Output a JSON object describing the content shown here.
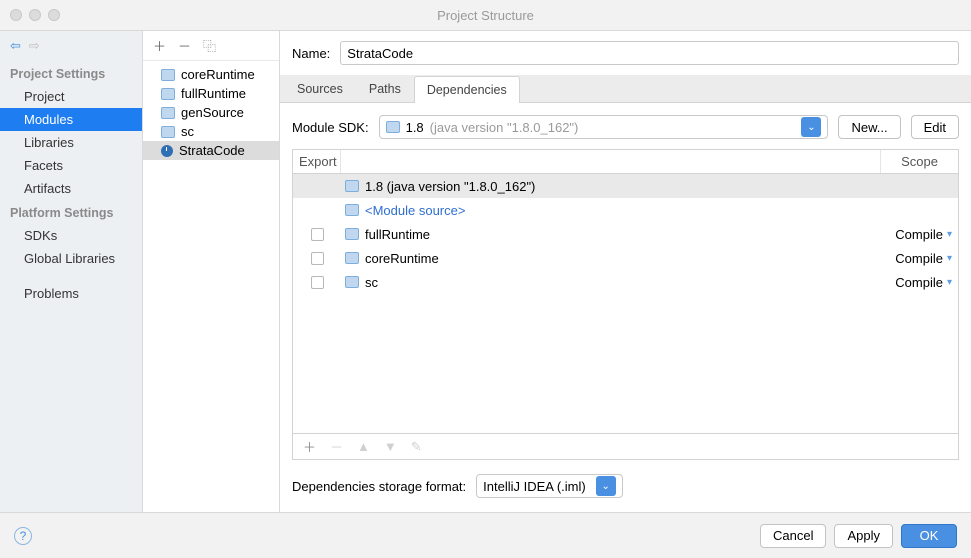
{
  "window": {
    "title": "Project Structure"
  },
  "sidebar": {
    "sectionA": "Project Settings",
    "itemsA": [
      "Project",
      "Modules",
      "Libraries",
      "Facets",
      "Artifacts"
    ],
    "selectedA": "Modules",
    "sectionB": "Platform Settings",
    "itemsB": [
      "SDKs",
      "Global Libraries"
    ],
    "sectionC_item": "Problems"
  },
  "modules": {
    "items": [
      {
        "name": "coreRuntime",
        "icon": "folder"
      },
      {
        "name": "fullRuntime",
        "icon": "folder"
      },
      {
        "name": "genSource",
        "icon": "folder"
      },
      {
        "name": "sc",
        "icon": "folder"
      },
      {
        "name": "StrataCode",
        "icon": "clock"
      }
    ],
    "selected": "StrataCode"
  },
  "main": {
    "name_label": "Name:",
    "name_value": "StrataCode",
    "tabs": [
      "Sources",
      "Paths",
      "Dependencies"
    ],
    "active_tab": "Dependencies",
    "sdk_label": "Module SDK:",
    "sdk_version": "1.8",
    "sdk_detail": "(java version \"1.8.0_162\")",
    "new_btn": "New...",
    "edit_btn": "Edit",
    "table": {
      "header_export": "Export",
      "header_scope": "Scope",
      "rows": [
        {
          "export": null,
          "icon": "folder",
          "label": "1.8 (java version \"1.8.0_162\")",
          "link": false,
          "scope": "",
          "highlight": true
        },
        {
          "export": null,
          "icon": "folder",
          "label": "<Module source>",
          "link": true,
          "scope": ""
        },
        {
          "export": false,
          "icon": "folder",
          "label": "fullRuntime",
          "link": false,
          "scope": "Compile"
        },
        {
          "export": false,
          "icon": "folder",
          "label": "coreRuntime",
          "link": false,
          "scope": "Compile"
        },
        {
          "export": false,
          "icon": "folder",
          "label": "sc",
          "link": false,
          "scope": "Compile"
        }
      ]
    },
    "storage_label": "Dependencies storage format:",
    "storage_value": "IntelliJ IDEA (.iml)"
  },
  "footer": {
    "cancel": "Cancel",
    "apply": "Apply",
    "ok": "OK"
  }
}
